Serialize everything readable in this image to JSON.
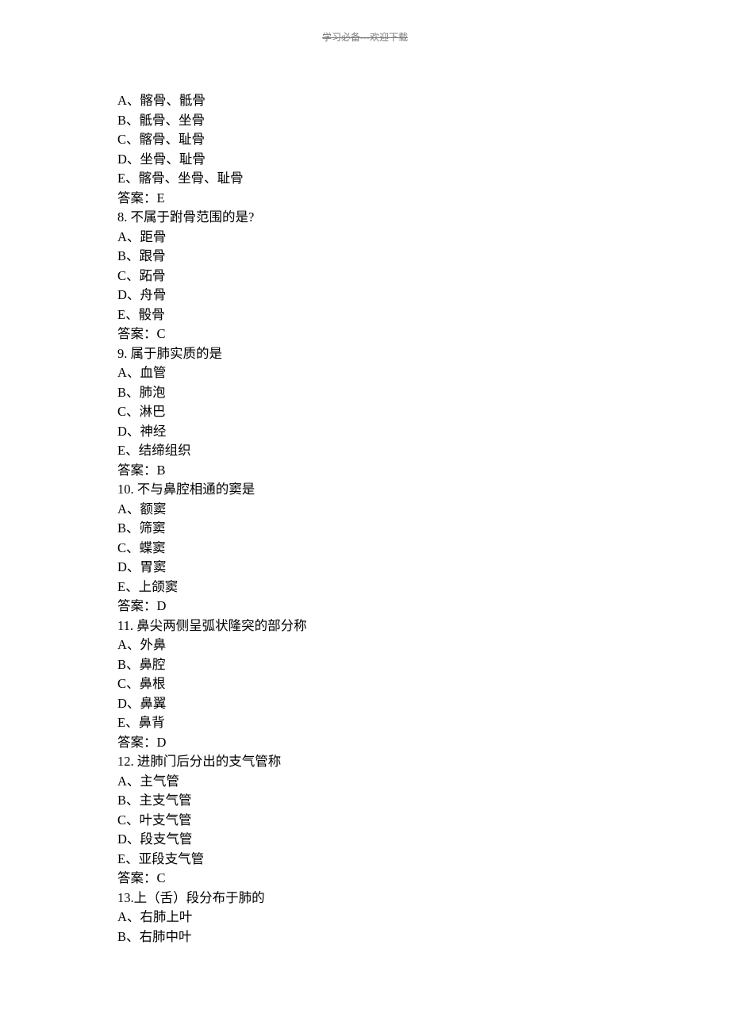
{
  "header": "学习必备---欢迎下载",
  "lines": [
    "A、髂骨、骶骨",
    "B、骶骨、坐骨",
    "C、髂骨、耻骨",
    "D、坐骨、耻骨",
    "E、髂骨、坐骨、耻骨",
    "答案：E",
    "8.  不属于跗骨范围的是?",
    "A、距骨",
    "B、跟骨",
    "C、跖骨",
    "D、舟骨",
    "E、骰骨",
    "答案：C",
    "9.  属于肺实质的是",
    "A、血管",
    "B、肺泡",
    "C、淋巴",
    "D、神经",
    "E、结缔组织",
    "答案：B",
    "10.  不与鼻腔相通的窦是",
    "A、额窦",
    "B、筛窦",
    "C、蝶窦",
    "D、胃窦",
    "E、上颌窦",
    "答案：D",
    "11.  鼻尖两侧呈弧状隆突的部分称",
    "A、外鼻",
    "B、鼻腔",
    "C、鼻根",
    "D、鼻翼",
    "E、鼻背",
    "答案：D",
    "12.  进肺门后分出的支气管称",
    "A、主气管",
    "B、主支气管",
    "C、叶支气管",
    "D、段支气管",
    "E、亚段支气管",
    "答案：C",
    "13.上（舌）段分布于肺的",
    "A、右肺上叶",
    "B、右肺中叶"
  ]
}
